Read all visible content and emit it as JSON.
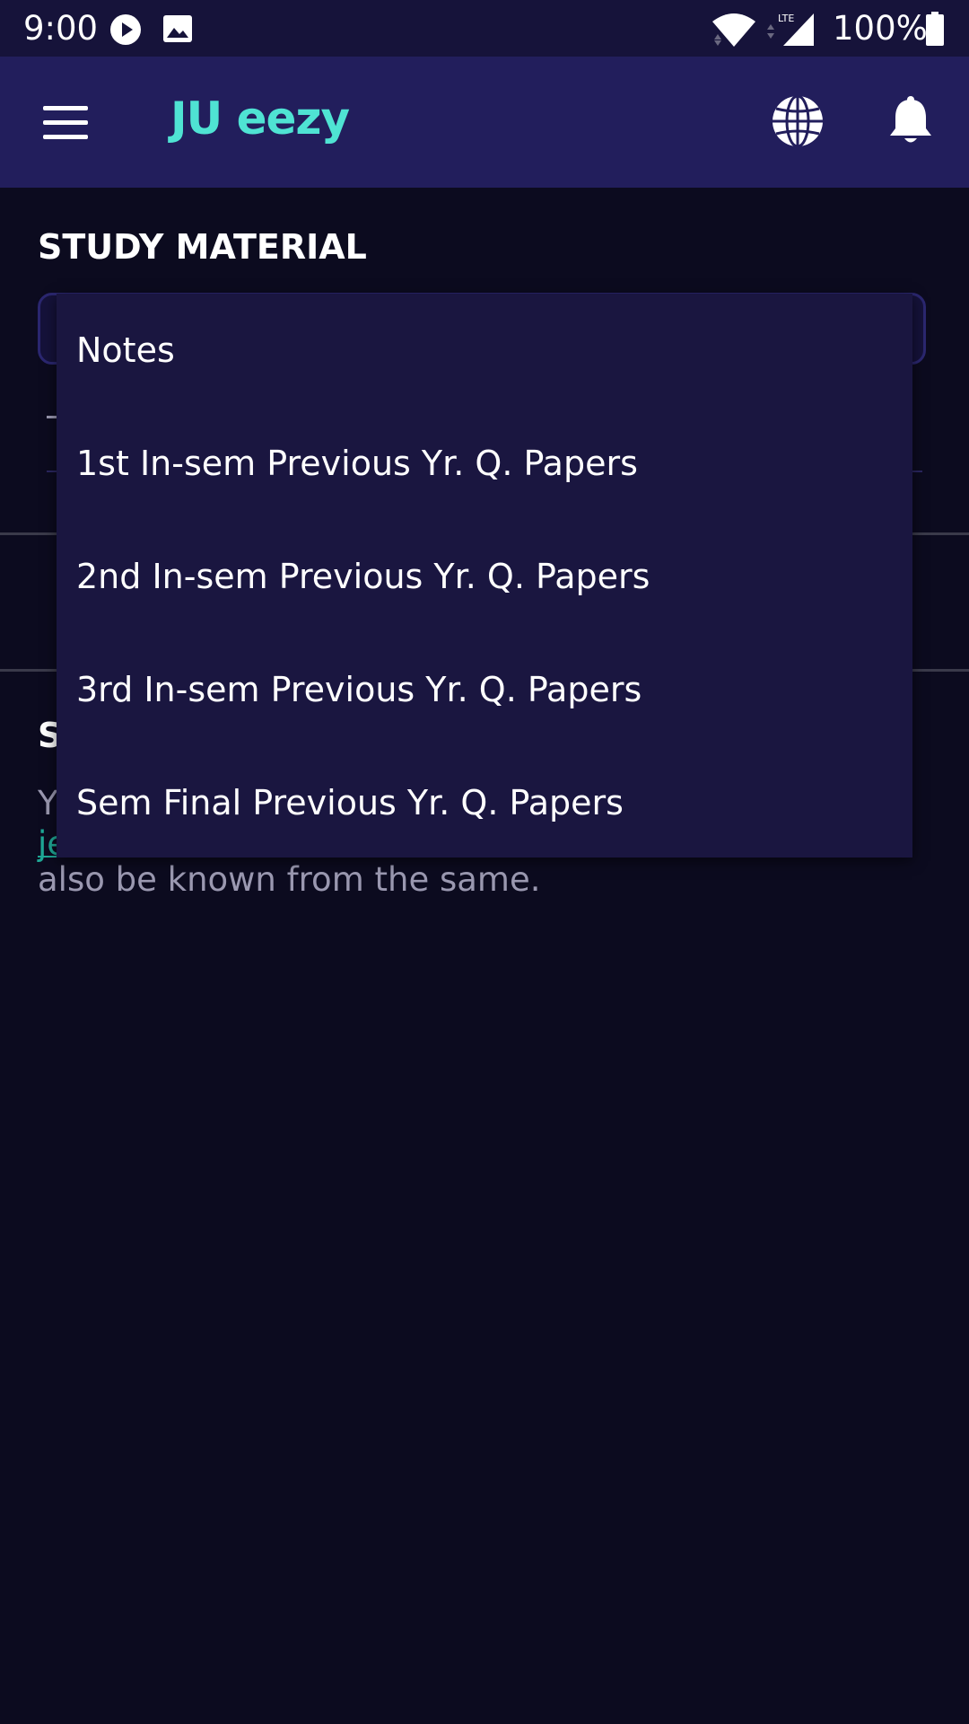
{
  "status_bar": {
    "time": "9:00",
    "battery": "100%",
    "network_label": "LTE",
    "icons": [
      "play-icon",
      "image-icon",
      "wifi-icon",
      "signal-icon",
      "battery-icon"
    ]
  },
  "app_bar": {
    "title": "JU eezy",
    "icons": [
      "menu-icon",
      "globe-icon",
      "bell-icon"
    ]
  },
  "main": {
    "section_title": "STUDY MATERIAL",
    "obscured_heading": "S",
    "obscured_text_start": "Y",
    "obscured_link_start": "je",
    "body_text": "also be known from the same."
  },
  "dropdown": {
    "options": [
      "Notes",
      "1st In-sem Previous Yr. Q. Papers",
      "2nd In-sem Previous Yr. Q. Papers",
      "3rd In-sem Previous Yr. Q. Papers",
      "Sem Final Previous Yr. Q. Papers"
    ]
  },
  "colors": {
    "status_bar_bg": "#16133a",
    "app_bar_bg": "#221e5c",
    "page_bg": "#0c0b1f",
    "accent": "#4fe3d3",
    "dropdown_bg": "#1a1640",
    "link": "#1fa896"
  }
}
